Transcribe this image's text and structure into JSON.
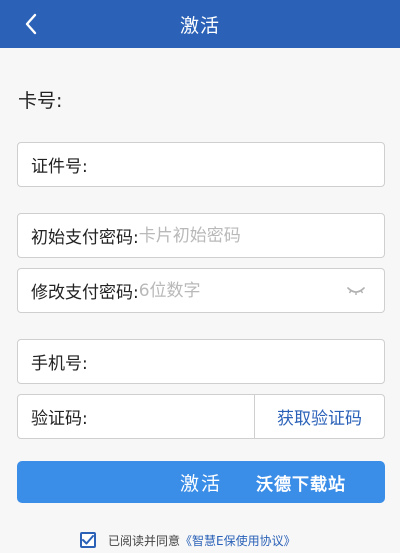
{
  "header": {
    "title": "激活"
  },
  "card": {
    "label": "卡号:"
  },
  "form": {
    "id_number": {
      "label": "证件号:",
      "value": "",
      "placeholder": ""
    },
    "initial_password": {
      "label": "初始支付密码:",
      "value": "",
      "placeholder": "卡片初始密码"
    },
    "modify_password": {
      "label": "修改支付密码:",
      "value": "",
      "placeholder": "6位数字"
    },
    "phone": {
      "label": "手机号:",
      "value": "",
      "placeholder": ""
    },
    "verify_code": {
      "label": "验证码:",
      "value": "",
      "placeholder": "",
      "button_label": "获取验证码"
    }
  },
  "actions": {
    "activate_label": "激活"
  },
  "watermark": {
    "text": "沃德下载站"
  },
  "agreement": {
    "checked": true,
    "prefix": "已阅读并同意",
    "link_text": "《智慧E保使用协议》"
  },
  "icons": {
    "back": "chevron-left-icon",
    "eye": "eye-closed-icon",
    "check": "checkbox-checked-icon"
  },
  "colors": {
    "header_bg": "#2b62b8",
    "accent": "#2b62b8",
    "button_bg": "#3b8ee8",
    "page_bg": "#f7f7f7",
    "border": "#cfcfcf",
    "placeholder": "#b9b9b9"
  }
}
